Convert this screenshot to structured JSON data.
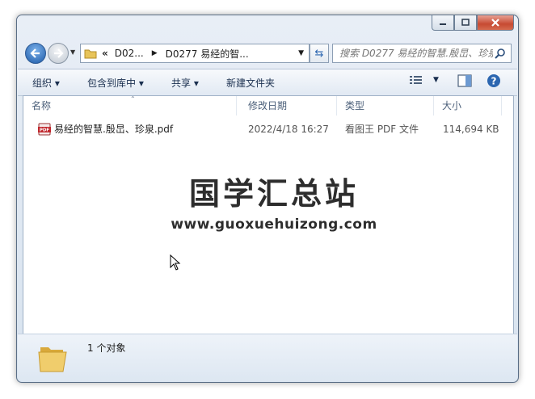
{
  "window": {
    "minimize_icon": "minimize-icon",
    "maximize_icon": "maximize-icon",
    "close_icon": "close-icon"
  },
  "address": {
    "overflow": "«",
    "crumbs": [
      "D02...",
      "D0277 易经的智..."
    ],
    "search_placeholder": "搜索 D0277 易经的智慧.殷旵、珍泉"
  },
  "toolbar": {
    "organize": "组织",
    "include_in_library": "包含到库中",
    "share": "共享",
    "new_folder": "新建文件夹"
  },
  "columns": {
    "name": "名称",
    "date": "修改日期",
    "type": "类型",
    "size": "大小"
  },
  "files": [
    {
      "name": "易经的智慧.殷旵、珍泉.pdf",
      "date": "2022/4/18 16:27",
      "type": "看图王 PDF 文件",
      "size": "114,694 KB",
      "icon": "pdf-icon",
      "icon_text": "PDF"
    }
  ],
  "watermark": {
    "cn": "国学汇总站",
    "url": "www.guoxuehuizong.com"
  },
  "details": {
    "count": "1 个对象"
  },
  "colors": {
    "accent": "#2c66b0",
    "pdf_red": "#c1272d",
    "folder": "#e8c45a"
  }
}
